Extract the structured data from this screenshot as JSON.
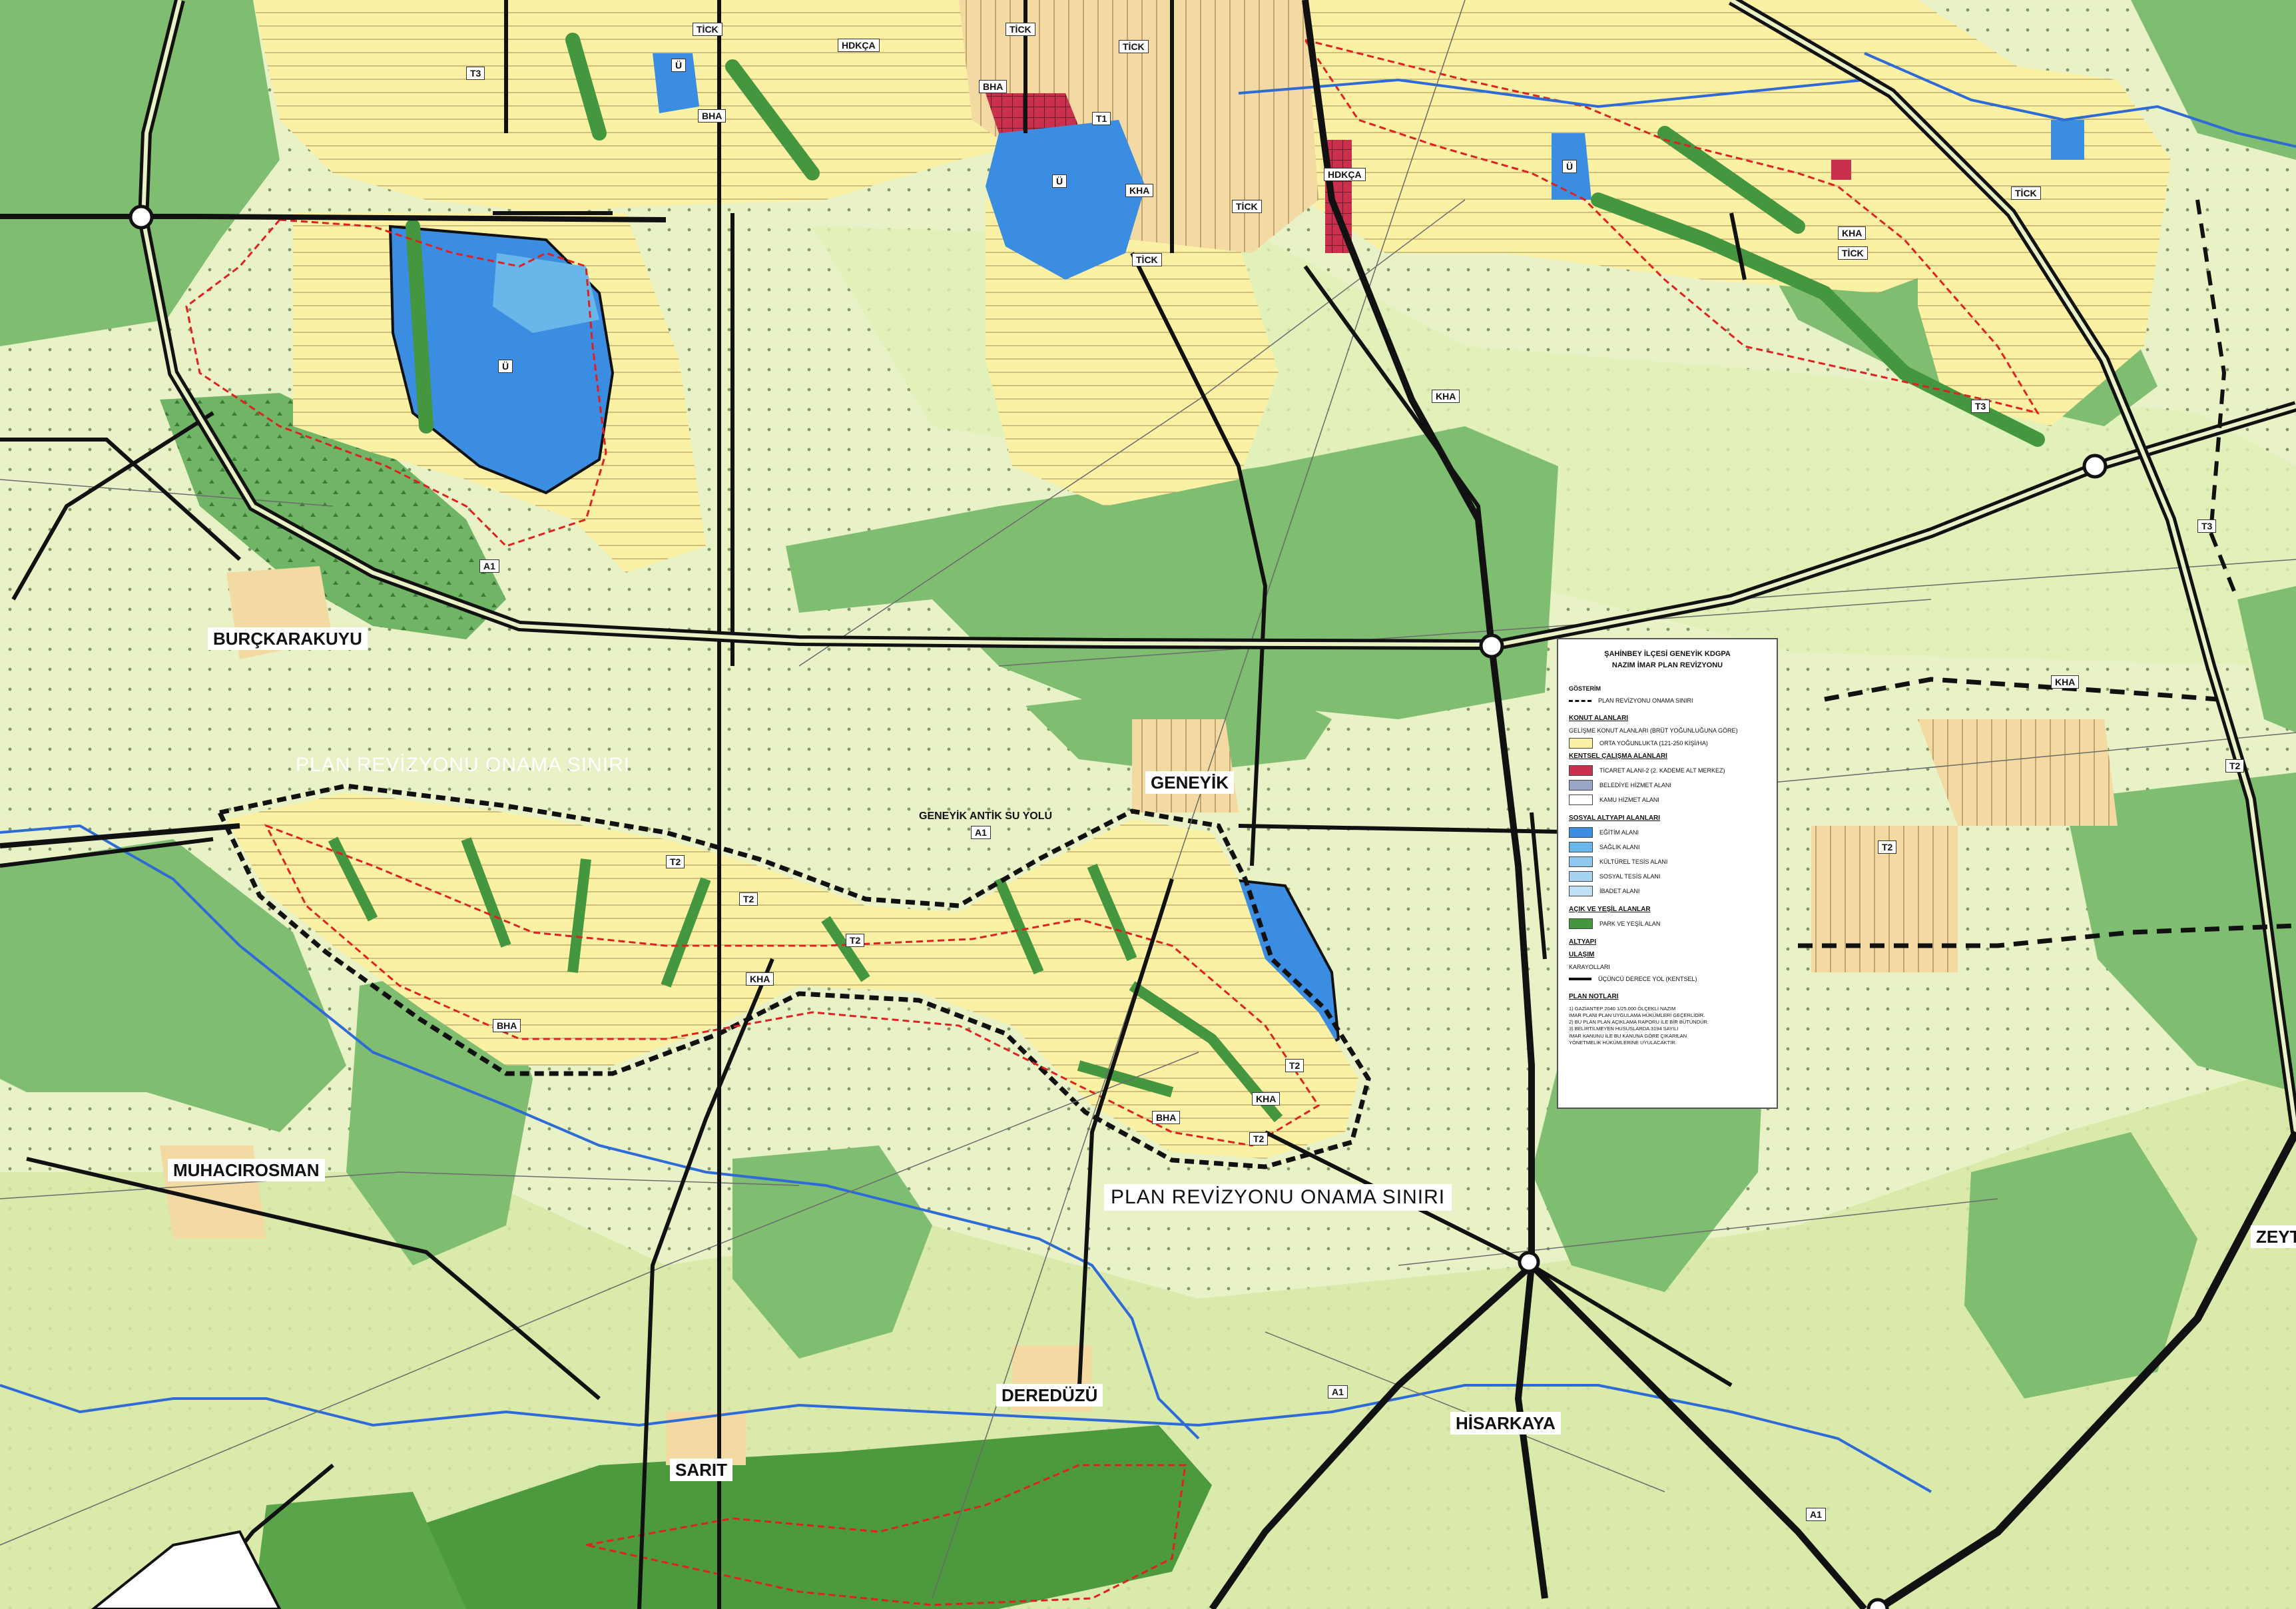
{
  "places": {
    "burckarakuyu": "BURÇKARAKUYU",
    "geneyik": "GENEYİK",
    "geneyik_antik": "GENEYİK ANTİK SU YOLU",
    "muhacirosman": "MUHACIROSMAN",
    "dereduzu": "DEREDÜZÜ",
    "sarit": "SARIT",
    "hisarkaya": "HİSARKAYA",
    "zeytinli": "ZEYTİNLİ"
  },
  "boundary_labels": {
    "west": "PLAN REVİZYONU ONAMA SINIRI",
    "south": "PLAN REVİZYONU ONAMA SINIRI"
  },
  "zone_tags": [
    "TİCK",
    "TİCK",
    "TİCK",
    "TİCK",
    "TİCK",
    "TİCK",
    "TİCK",
    "KHA",
    "KHA",
    "KHA",
    "KHA",
    "KHA",
    "KHA",
    "BHA",
    "BHA",
    "BHA",
    "BHA",
    "T1",
    "T2",
    "T2",
    "T2",
    "T2",
    "T2",
    "T2",
    "T2",
    "T3",
    "T3",
    "T3",
    "A1",
    "A1",
    "A1",
    "A1",
    "Ü",
    "Ü",
    "Ü",
    "Ü",
    "HDKÇA",
    "HDKÇA"
  ],
  "legend": {
    "title": [
      "ŞAHİNBEY İLÇESİ GENEYİK KDGPA",
      "NAZIM İMAR PLAN REVİZYONU"
    ],
    "gosterim": "GÖSTERİM",
    "boundary_item": "PLAN REVİZYONU ONAMA SINIRI",
    "konut_head": "KONUT ALANLARI",
    "konut_sub": "GELİŞME KONUT ALANLARI (BRÜT YOĞUNLUĞUNA GÖRE)",
    "orta": "ORTA YOĞUNLUKTA (121-250 KİŞİ/HA)",
    "kentsel_head": "KENTSEL ÇALIŞMA ALANLARI",
    "ticaret": "TİCARET ALANI-2 (2. KADEME ALT MERKEZ)",
    "belediye": "BELEDİYE HİZMET ALANI",
    "kamu": "KAMU HİZMET ALANI",
    "sosyal_head": "SOSYAL ALTYAPI ALANLARI",
    "egitim": "EĞİTİM ALANI",
    "saglik": "SAĞLIK ALANI",
    "kulturel": "KÜLTÜREL TESİS ALANI",
    "sosyal": "SOSYAL TESİS ALANI",
    "ibadet": "İBADET ALANI",
    "acik_head": "AÇIK VE YEŞİL ALANLAR",
    "park": "PARK VE YEŞİL ALAN",
    "altyapi_head": "ALTYAPI",
    "ulasim_head": "ULAŞIM",
    "karayollari": "KARAYOLLARI",
    "ucuncu": "ÜÇÜNCÜ DERECE YOL (KENTSEL)",
    "notlar_head": "PLAN NOTLARI",
    "notes": [
      "1) GAZİANTEP 2040 1/25.000 ÖLÇEKLİ NAZIM",
      "İMAR PLANI PLAN UYGULAMA HÜKÜMLERİ GEÇERLİDİR.",
      "2) BU PLAN PLAN AÇIKLAMA RAPORU İLE BİR BÜTÜNDÜR.",
      "3) BELİRTİLMEYEN HUSUSLARDA 3194 SAYILI",
      "İMAR KANUNU İLE BU KANUNA GÖRE ÇIKARILAN",
      "YÖNETMELİK HÜKÜMLERİNE UYULACAKTIR."
    ]
  },
  "colors": {
    "agri": "#e8f2c6",
    "agri_dark": "#d6e9a6",
    "forest": "#7fbe71",
    "park": "#44963f",
    "residential": "#fbf1a5",
    "development": "#f3d9a2",
    "water": "#3a8de0",
    "water_light": "#69b7ea",
    "commerce": "#c9304e",
    "road": "#111111"
  }
}
